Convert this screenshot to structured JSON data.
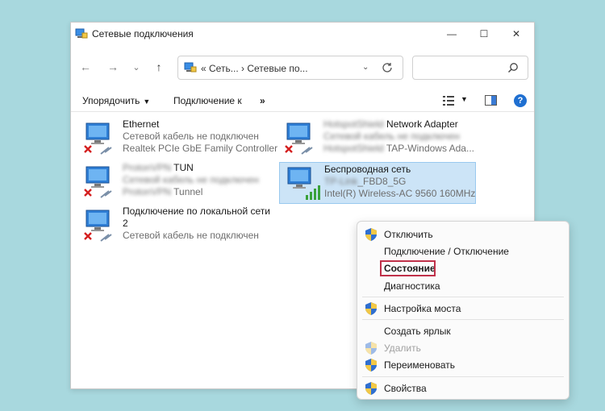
{
  "window": {
    "title": "Сетевые подключения",
    "controls": {
      "minimize": "—",
      "maximize": "☐",
      "close": "✕"
    }
  },
  "navbar": {
    "back": "←",
    "forward": "→",
    "recent": "⌄",
    "up": "↑",
    "address": "«  Сеть...  ›  Сетевые по...",
    "address_chevron": "⌄",
    "search_placeholder": ""
  },
  "toolbar": {
    "organize_label": "Упорядочить",
    "connect_label": "Подключение к",
    "more_label": "»"
  },
  "connections": [
    {
      "name": "Ethernet",
      "status": "Сетевой кабель не подключен",
      "device": "Realtek PCIe GbE Family Controller",
      "state": "disconnected"
    },
    {
      "name_blur": "HotspotShield",
      "name": " Network Adapter",
      "status_blur": "Сетевой кабель не подключен",
      "device_blur": "HotspotShield",
      "device": " TAP-Windows Ada...",
      "state": "disconnected"
    },
    {
      "name_blur": "ProtonVPN",
      "name": " TUN",
      "status_blur": "Сетевой кабель не подключен",
      "device_blur": "ProtonVPN",
      "device": " Tunnel",
      "state": "disconnected"
    },
    {
      "name": "Беспроводная сеть",
      "status_blur": "TP-Link",
      "status": "_FBD8_5G",
      "device": "Intel(R) Wireless-AC 9560 160MHz",
      "state": "wireless"
    },
    {
      "name": "Подключение по локальной сети",
      "name2": "2",
      "status": "Сетевой кабель не подключен",
      "state": "disconnected"
    }
  ],
  "context_menu": [
    {
      "label": "Отключить",
      "shield": true
    },
    {
      "label": "Подключение / Отключение"
    },
    {
      "label": "Состояние",
      "bold": true
    },
    {
      "label": "Диагностика"
    },
    {
      "label": "Настройка моста",
      "shield": true
    },
    {
      "label": "Создать ярлык"
    },
    {
      "label": "Удалить",
      "shield": true,
      "disabled": true
    },
    {
      "label": "Переименовать",
      "shield": true
    },
    {
      "label": "Свойства",
      "shield": true
    }
  ],
  "colors": {
    "highlight": "#c0314a",
    "selection": "#cce4f7",
    "accent": "#1f6fd1"
  }
}
